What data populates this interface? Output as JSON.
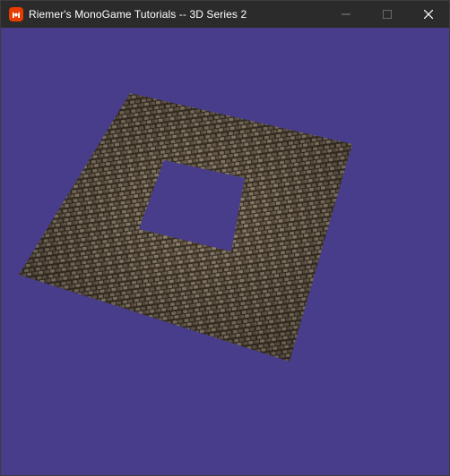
{
  "window": {
    "title": "Riemer's MonoGame Tutorials -- 3D Series 2",
    "app_icon": "monogame-logo-icon",
    "controls": {
      "minimize": "minimize-icon",
      "maximize": "maximize-icon",
      "close": "close-icon"
    }
  },
  "viewport": {
    "background_color": "#483d8b",
    "content": "cobblestone-floor-with-square-hole"
  },
  "colors": {
    "titlebar": "#2b2b2b",
    "brand_icon": "#e73c00",
    "title_text": "#ffffff",
    "cobble_dark": "#3d3326",
    "cobble_light": "#8a7d6a"
  }
}
